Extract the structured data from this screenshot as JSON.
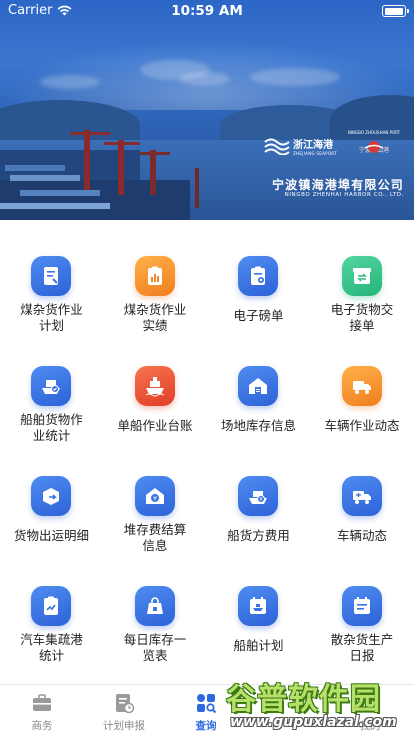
{
  "status_bar": {
    "carrier": "Carrier",
    "time": "10:59 AM",
    "battery_level": 1.0
  },
  "banner": {
    "brand_zj": "浙江海港",
    "brand_zj_en": "ZHEJIANG SEAPORT",
    "brand_nb_en": "NINGBO ZHOUSHAN PORT",
    "brand_nb": "宁波舟山港",
    "company_name": "宁波镇海港埠有限公司",
    "company_en": "NINGBO ZHENHAI HARBOR CO., LTD."
  },
  "grid": [
    {
      "label": "煤杂货作业计划",
      "lines": [
        "煤杂货作业",
        "计划"
      ],
      "icon": "document-plan-icon",
      "color": "blue"
    },
    {
      "label": "煤杂货作业实绩",
      "lines": [
        "煤杂货作业",
        "实绩"
      ],
      "icon": "clipboard-chart-icon",
      "color": "orange"
    },
    {
      "label": "电子磅单",
      "lines": [
        "电子磅单"
      ],
      "icon": "clipboard-gear-icon",
      "color": "blue"
    },
    {
      "label": "电子货物交接单",
      "lines": [
        "电子货物交",
        "接单"
      ],
      "icon": "box-transfer-icon",
      "color": "green"
    },
    {
      "label": "船舶货物作业统计",
      "lines": [
        "船舶货物作",
        "业统计"
      ],
      "icon": "ship-cargo-icon",
      "color": "blue"
    },
    {
      "label": "单船作业台账",
      "lines": [
        "单船作业台账"
      ],
      "icon": "ship-ledger-icon",
      "color": "red"
    },
    {
      "label": "场地库存信息",
      "lines": [
        "场地库存信息"
      ],
      "icon": "warehouse-icon",
      "color": "blue"
    },
    {
      "label": "车辆作业动态",
      "lines": [
        "车辆作业动态"
      ],
      "icon": "truck-icon",
      "color": "orange"
    },
    {
      "label": "货物出运明细",
      "lines": [
        "货物出运明细"
      ],
      "icon": "box-out-icon",
      "color": "blue"
    },
    {
      "label": "堆存费结算信息",
      "lines": [
        "堆存费结算",
        "信息"
      ],
      "icon": "fee-settlement-icon",
      "color": "blue"
    },
    {
      "label": "船货方费用",
      "lines": [
        "船货方费用"
      ],
      "icon": "ship-fee-icon",
      "color": "blue"
    },
    {
      "label": "车辆动态",
      "lines": [
        "车辆动态"
      ],
      "icon": "truck-status-icon",
      "color": "blue"
    },
    {
      "label": "汽车集疏港统计",
      "lines": [
        "汽车集疏港",
        "统计"
      ],
      "icon": "clipboard-stats-icon",
      "color": "blue"
    },
    {
      "label": "每日库存一览表",
      "lines": [
        "每日库存一",
        "览表"
      ],
      "icon": "inventory-bag-icon",
      "color": "blue"
    },
    {
      "label": "船舶计划",
      "lines": [
        "船舶计划"
      ],
      "icon": "calendar-ship-icon",
      "color": "blue"
    },
    {
      "label": "散杂货生产日报",
      "lines": [
        "散杂货生产",
        "日报"
      ],
      "icon": "calendar-report-icon",
      "color": "blue"
    }
  ],
  "tabbar": {
    "tabs": [
      {
        "label": "商务",
        "icon": "briefcase-icon",
        "active": false
      },
      {
        "label": "计划申报",
        "icon": "plan-report-icon",
        "active": false
      },
      {
        "label": "查询",
        "icon": "query-grid-icon",
        "active": true
      },
      {
        "label": "我的",
        "icon": "user-icon",
        "active": false
      }
    ]
  },
  "watermark": {
    "text": "谷普软件园",
    "url": "www.gupuxlazal.com"
  },
  "colors": {
    "blue": "#2d62d8",
    "orange": "#f07d1e",
    "red": "#e03e26",
    "green": "#24b57a",
    "tab_active": "#2d6ae0"
  }
}
